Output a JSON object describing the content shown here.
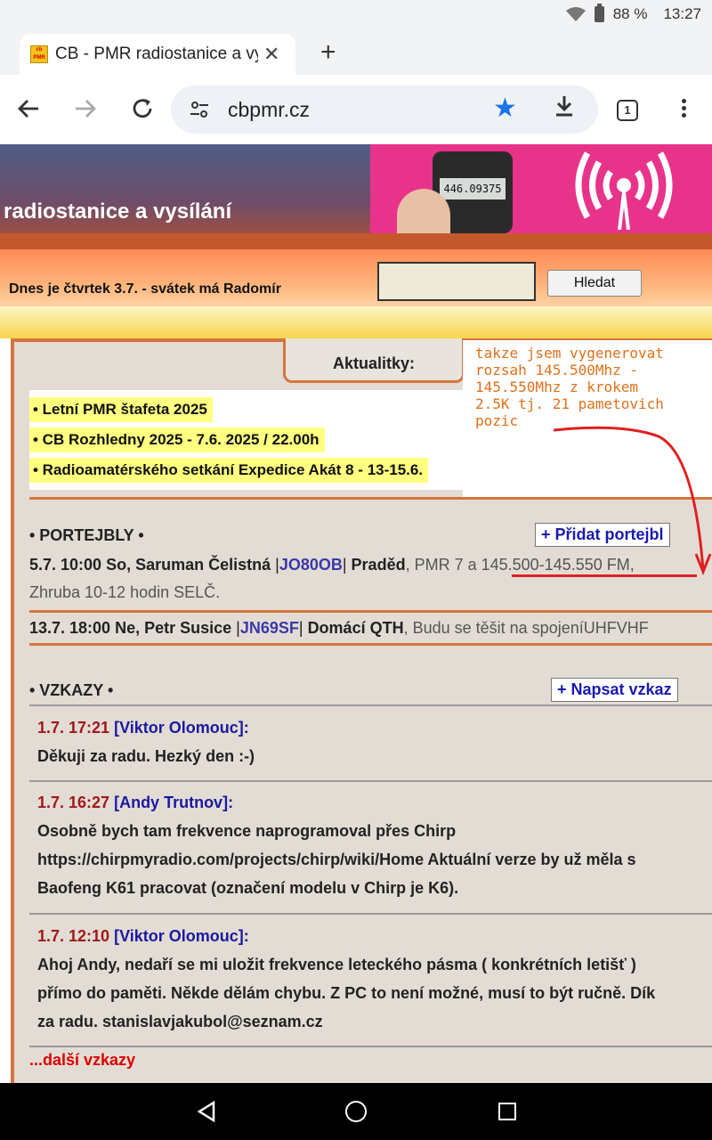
{
  "status": {
    "battery": "88 %",
    "time": "13:27"
  },
  "tab": {
    "favicon_text": "cb PMR",
    "title": "CB - PMR radiostanice a vysílání"
  },
  "toolbar": {
    "url": "cbpmr.cz",
    "tab_count": "1"
  },
  "banner": {
    "title": "radiostanice a vysílání",
    "radio_display": "446.09375"
  },
  "datebar": {
    "text": "Dnes je čtvrtek 3.7. - svátek má Radomír",
    "search_placeholder": "",
    "search_button": "Hledat"
  },
  "news": {
    "tab_label": "Aktualitky:",
    "items": [
      "• Letní PMR štafeta 2025",
      "• CB Rozhledny 2025 - 7.6. 2025 / 22.00h",
      "• Radioamatérského setkání Expedice Akát 8 - 13-15.6."
    ]
  },
  "annotation": "takze jsem vygenerovat\nrozsah 145.500Mhz -\n145.550Mhz z krokem\n2.5K tj. 21 pametovich\npozic",
  "portejbly": {
    "title": "• PORTEJBLY •",
    "add_button": "+ Přidat portejbl",
    "rows": [
      {
        "when": "5.7. 10:00 So, Saruman Čelistná",
        "locator": "JO80OB",
        "place": "Praděd",
        "info": ", PMR 7 a 145.500-145.550 FM,",
        "info2": "Zhruba 10-12 hodin SELČ."
      },
      {
        "when": "13.7. 18:00 Ne, Petr Susice",
        "locator": "JN69SF",
        "place": "Domácí QTH",
        "info": ", Budu se těšit na spojeníUHFVHF"
      }
    ]
  },
  "vzkazy": {
    "title": "• VZKAZY •",
    "add_button": "+ Napsat vzkaz",
    "messages": [
      {
        "time": "1.7. 17:21",
        "author": "[Viktor Olomouc]:",
        "lines": [
          "Děkuji za radu. Hezký den :-)"
        ]
      },
      {
        "time": "1.7. 16:27",
        "author": "[Andy Trutnov]:",
        "lines": [
          "Osobně bych tam frekvence naprogramoval přes Chirp",
          "https://chirpmyradio.com/projects/chirp/wiki/Home Aktuální verze by už měla s",
          "Baofeng K61 pracovat (označení modelu v Chirp je K6)."
        ]
      },
      {
        "time": "1.7. 12:10",
        "author": "[Viktor Olomouc]:",
        "lines": [
          "Ahoj Andy, nedaří se mi uložit frekvence leteckého pásma ( konkrétních letišť )",
          "přímo do paměti. Někde dělám chybu. Z PC to není možné, musí to být ručně. Dík",
          "za radu. stanislavjakubol@seznam.cz"
        ]
      }
    ],
    "more_link": "...další vzkazy"
  }
}
